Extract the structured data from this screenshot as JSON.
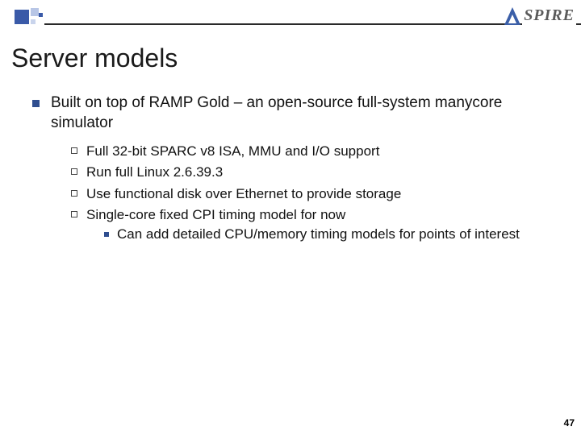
{
  "logo_text": "SPIRE",
  "title": "Server models",
  "bullets": {
    "main": "Built on top of RAMP Gold – an open-source full-system manycore simulator",
    "subs": [
      "Full 32-bit SPARC v8 ISA, MMU and I/O support",
      "Run full Linux 2.6.39.3",
      "Use functional disk over Ethernet to provide storage",
      "Single-core fixed CPI timing model for now"
    ],
    "subsub": "Can add detailed CPU/memory timing models for points of interest"
  },
  "page_number": "47"
}
